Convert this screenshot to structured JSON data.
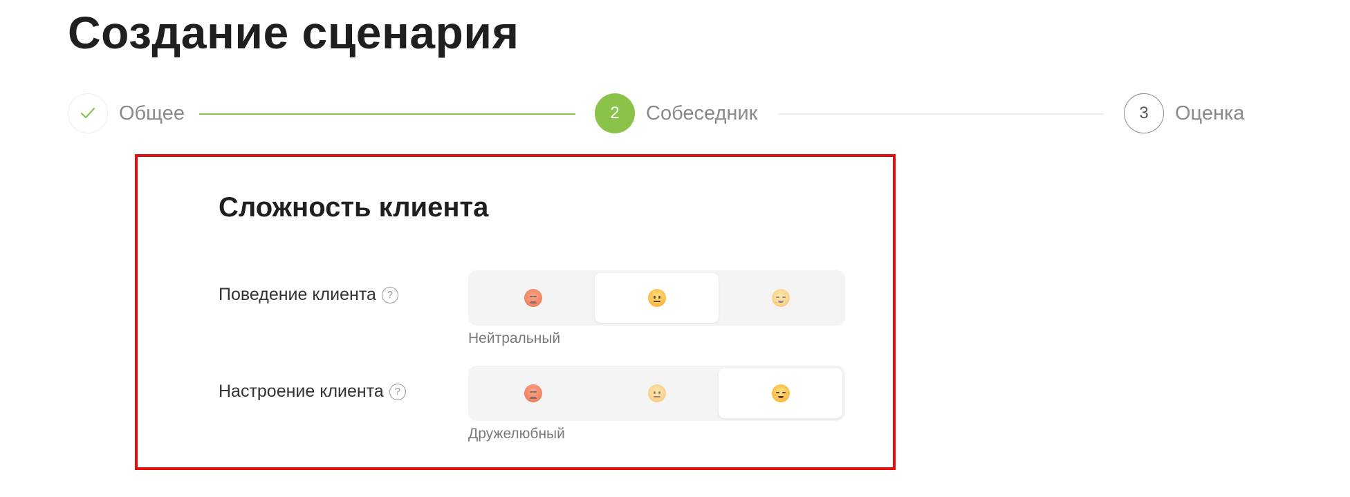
{
  "page_title": "Создание сценария",
  "stepper": {
    "steps": [
      {
        "label": "Общее",
        "status": "completed",
        "marker": "✓"
      },
      {
        "label": "Собеседник",
        "status": "active",
        "marker": "2"
      },
      {
        "label": "Оценка",
        "status": "pending",
        "marker": "3"
      }
    ],
    "accent_color": "#8bc34a"
  },
  "section": {
    "title": "Сложность клиента",
    "fields": [
      {
        "label": "Поведение клиента",
        "help": "?",
        "options": [
          "angry-emoji",
          "neutral-emoji",
          "calm-emoji"
        ],
        "selected_index": 1,
        "selected_text": "Нейтральный"
      },
      {
        "label": "Настроение клиента",
        "help": "?",
        "options": [
          "angry-emoji",
          "neutral-emoji",
          "calm-emoji"
        ],
        "selected_index": 2,
        "selected_text": "Дружелюбный"
      }
    ]
  },
  "highlight_color": "#e20f0f"
}
